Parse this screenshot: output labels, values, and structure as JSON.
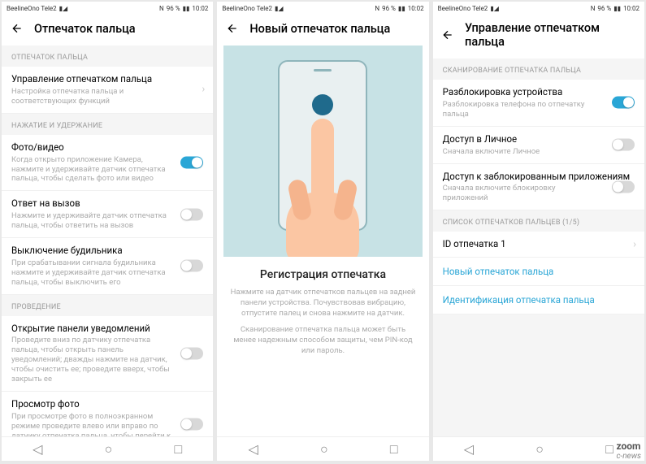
{
  "status": {
    "carrier": "BeelineOno Tele2",
    "nfc": "N",
    "battery": "96 %",
    "time": "10:02"
  },
  "screen1": {
    "title": "Отпечаток пальца",
    "sec1": "ОТПЕЧАТОК ПАЛЬЦА",
    "manage": {
      "title": "Управление отпечатком пальца",
      "sub": "Настройка отпечатка пальца и соответствующих функций"
    },
    "sec2": "НАЖАТИЕ И УДЕРЖАНИЕ",
    "photo": {
      "title": "Фото/видео",
      "sub": "Когда открыто приложение Камера, нажмите и удерживайте датчик отпечатка пальца, чтобы сделать фото или видео"
    },
    "answer": {
      "title": "Ответ на вызов",
      "sub": "Нажмите и удерживайте датчик отпечатка пальца, чтобы ответить на вызов"
    },
    "alarm": {
      "title": "Выключение будильника",
      "sub": "При срабатывании сигнала будильника нажмите и удерживайте датчик отпечатка пальца, чтобы выключить его"
    },
    "sec3": "ПРОВЕДЕНИЕ",
    "panel": {
      "title": "Открытие панели уведомлений",
      "sub": "Проведите вниз по датчику отпечатка пальца, чтобы открыть панель уведомлений; дважды нажмите на датчик, чтобы очистить ее; проведите вверх, чтобы закрыть ее"
    },
    "view": {
      "title": "Просмотр фото",
      "sub": "При просмотре фото в полноэкранном режиме проведите влево или вправо по датчику отпечатка пальца, чтобы перейти к предыдущему или следующему фото"
    }
  },
  "screen2": {
    "title": "Новый отпечаток пальца",
    "regTitle": "Регистрация отпечатка",
    "regText1": "Нажмите на датчик отпечатков пальцев на задней панели устройства. Почувствовав вибрацию, отпустите палец и снова нажмите на датчик.",
    "regText2": "Сканирование отпечатка пальца может быть менее надежным способом защиты, чем PIN-код или пароль."
  },
  "screen3": {
    "title": "Управление отпечатком пальца",
    "sec1": "СКАНИРОВАНИЕ ОТПЕЧАТКА ПАЛЬЦА",
    "unlock": {
      "title": "Разблокировка устройства",
      "sub": "Разблокировка телефона по отпечатку пальца"
    },
    "safe": {
      "title": "Доступ в Личное",
      "sub": "Сначала включите Личное"
    },
    "applock": {
      "title": "Доступ к заблокированным приложениям",
      "sub": "Сначала включите блокировку приложений"
    },
    "sec2": "СПИСОК ОТПЕЧАТКОВ ПАЛЬЦЕВ (1/5)",
    "fp1": "ID отпечатка 1",
    "new": "Новый отпечаток пальца",
    "identify": "Идентификация отпечатка пальца"
  },
  "watermark": "zoom",
  "watermark2": "c-news"
}
